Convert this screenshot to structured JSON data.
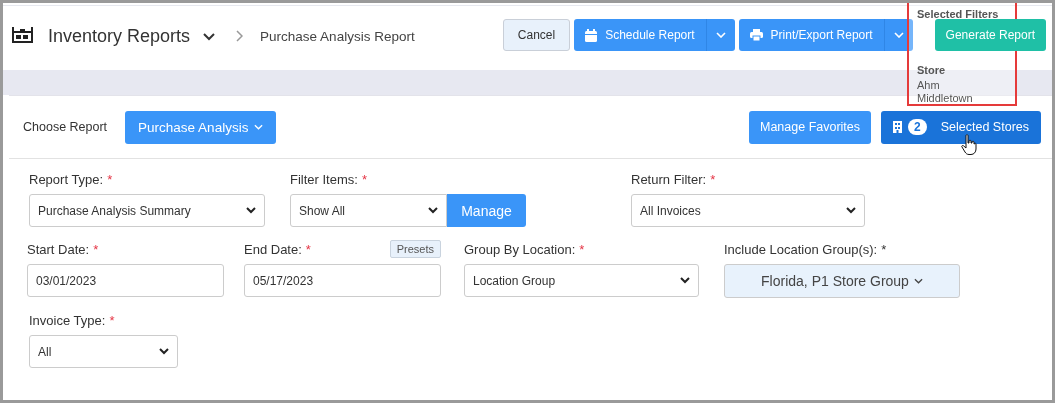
{
  "header": {
    "title": "Inventory Reports",
    "breadcrumb": "Purchase Analysis Report",
    "buttons": [
      {
        "label": "Cancel",
        "kind": "plain",
        "caret": false
      },
      {
        "label": "Schedule Report",
        "kind": "schedule",
        "caret": true
      },
      {
        "label": "Print/Export Report",
        "kind": "export",
        "caret": true
      },
      {
        "label": "Generate Report",
        "kind": "generate",
        "caret": false
      }
    ]
  },
  "popover": {
    "title": "Selected Filters",
    "sections": [
      {
        "heading": "Store",
        "items": [
          "Ahm",
          "Middletown"
        ]
      }
    ]
  },
  "toolbar": {
    "label": "Choose Report",
    "report": "Purchase Analysis",
    "favorites": "Manage Favorites",
    "stores_count": "2",
    "stores_label": "Selected Stores"
  },
  "rows": [
    [
      {
        "label": "Report Type:",
        "star": "*",
        "required": true,
        "kind": "select",
        "value": "Purchase Analysis Summary"
      },
      {
        "label": "Filter Items:",
        "star": "*",
        "required": true,
        "kind": "select-manage",
        "value": "Show All",
        "button": "Manage"
      },
      {
        "label": "Return Filter:",
        "star": "*",
        "required": true,
        "kind": "select",
        "value": "All Invoices"
      }
    ],
    [
      {
        "label": "Start Date:",
        "star": "*",
        "required": true,
        "kind": "input",
        "value": "03/01/2023"
      },
      {
        "label": "End Date:",
        "star": "*",
        "required": true,
        "kind": "input",
        "value": "05/17/2023",
        "presets": "Presets"
      },
      {
        "label": "Group By Location:",
        "star": "*",
        "required": true,
        "kind": "select",
        "value": "Location Group"
      },
      {
        "label": "Include Location Group(s):",
        "star": "*",
        "required": false,
        "kind": "multi",
        "value": "Florida, P1 Store Group"
      }
    ],
    [
      {
        "label": "Invoice Type:",
        "star": "*",
        "required": true,
        "kind": "select",
        "value": "All"
      }
    ]
  ]
}
